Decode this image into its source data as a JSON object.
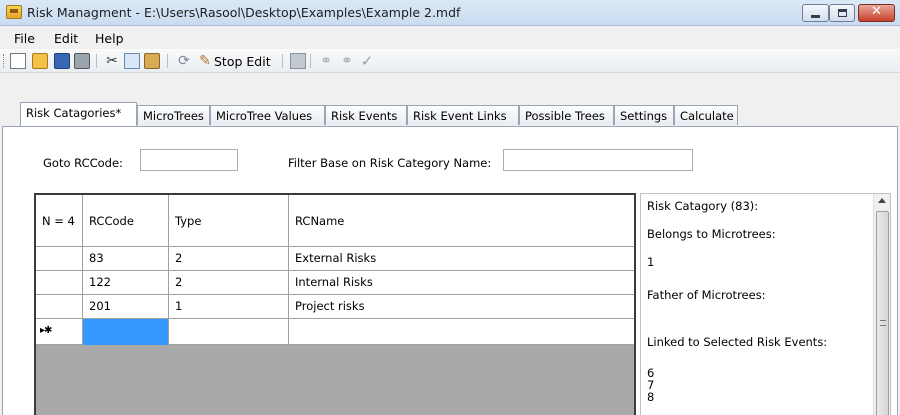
{
  "window": {
    "title": "Risk Managment - E:\\Users\\Rasool\\Desktop\\Examples\\Example 2.mdf"
  },
  "menu": {
    "items": [
      "File",
      "Edit",
      "Help"
    ]
  },
  "toolbar": {
    "stop_edit_label": "Stop Edit",
    "icons": [
      "new-icon",
      "open-icon",
      "save-icon",
      "print-icon",
      "cut-icon",
      "copy-icon",
      "paste-icon",
      "refresh-icon",
      "edit-icon",
      "table-icon",
      "link-icon",
      "unlink-icon",
      "check-icon"
    ]
  },
  "tabs": [
    {
      "label": "Risk Catagories*",
      "active": true
    },
    {
      "label": "MicroTrees",
      "active": false
    },
    {
      "label": "MicroTree Values",
      "active": false
    },
    {
      "label": "Risk Events",
      "active": false
    },
    {
      "label": "Risk Event Links",
      "active": false
    },
    {
      "label": "Possible Trees",
      "active": false
    },
    {
      "label": "Settings",
      "active": false
    },
    {
      "label": "Calculate",
      "active": false
    }
  ],
  "filters": {
    "goto_label": "Goto RCCode:",
    "goto_value": "",
    "filter_label": "Filter Base on Risk Category Name:",
    "filter_value": ""
  },
  "grid": {
    "count_header": "N = 4",
    "columns": [
      "RCCode",
      "Type",
      "RCName"
    ],
    "rows": [
      {
        "rccode": "83",
        "type": "2",
        "rcname": "External Risks"
      },
      {
        "rccode": "122",
        "type": "2",
        "rcname": "Internal Risks"
      },
      {
        "rccode": "201",
        "type": "1",
        "rcname": "Project risks"
      }
    ],
    "new_row_marker": "▸✱"
  },
  "info": {
    "title": "Risk Catagory (83):",
    "belongs_label": "Belongs to Microtrees:",
    "belongs_values": [
      "1"
    ],
    "father_label": "Father of Microtrees:",
    "father_values": [],
    "linked_label": "Linked to Selected Risk Events:",
    "linked_values": [
      "6",
      "7",
      "8"
    ]
  }
}
